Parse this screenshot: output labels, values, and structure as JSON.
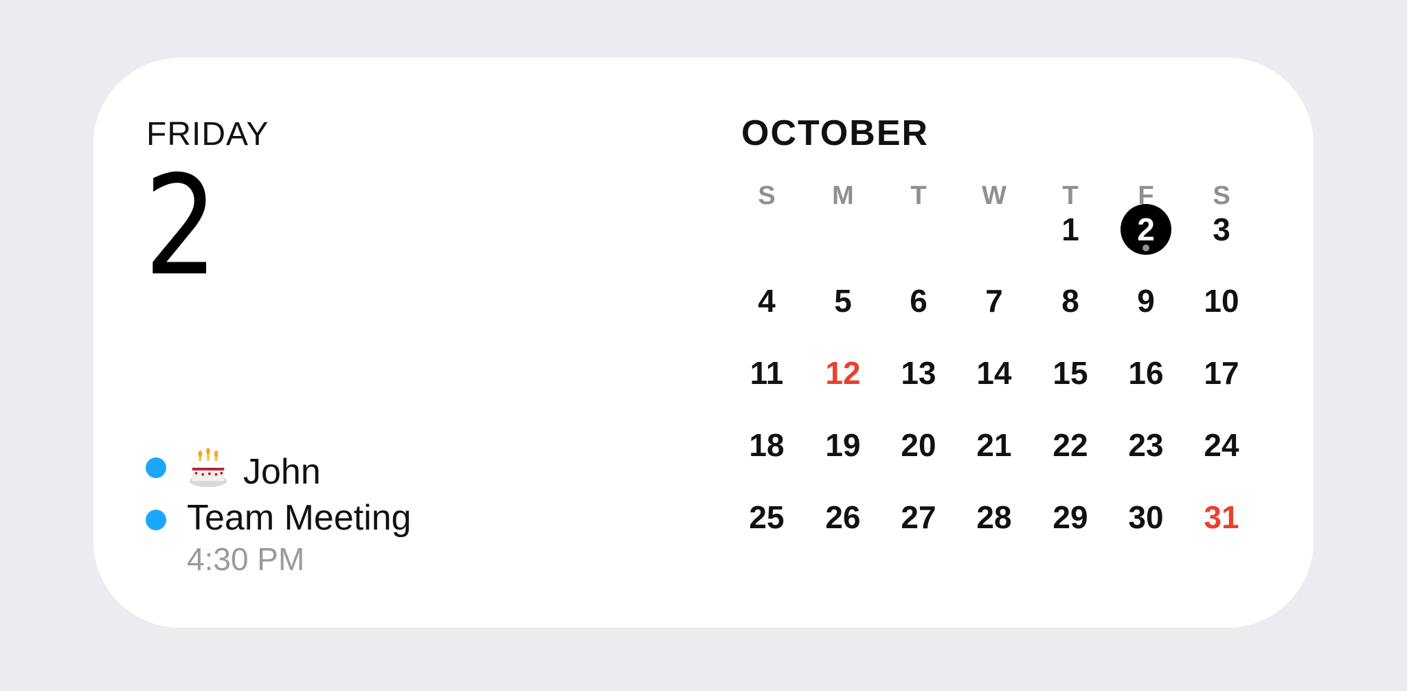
{
  "left": {
    "day_name": "FRIDAY",
    "day_number": "2",
    "events": [
      {
        "icon": "birthday-cake-icon",
        "title": "John",
        "time": "",
        "dot_color": "#1BA7FF"
      },
      {
        "icon": "",
        "title": "Team Meeting",
        "time": "4:30 PM",
        "dot_color": "#1BA7FF"
      }
    ]
  },
  "calendar": {
    "month": "OCTOBER",
    "weekdays": [
      "S",
      "M",
      "T",
      "W",
      "T",
      "F",
      "S"
    ],
    "today": 2,
    "highlight_color": "#E8412E",
    "weeks": [
      [
        "",
        "",
        "",
        "",
        "1",
        "2",
        "3"
      ],
      [
        "4",
        "5",
        "6",
        "7",
        "8",
        "9",
        "10"
      ],
      [
        "11",
        "12",
        "13",
        "14",
        "15",
        "16",
        "17"
      ],
      [
        "18",
        "19",
        "20",
        "21",
        "22",
        "23",
        "24"
      ],
      [
        "25",
        "26",
        "27",
        "28",
        "29",
        "30",
        "31"
      ]
    ],
    "highlighted_days": [
      "12",
      "31"
    ]
  }
}
